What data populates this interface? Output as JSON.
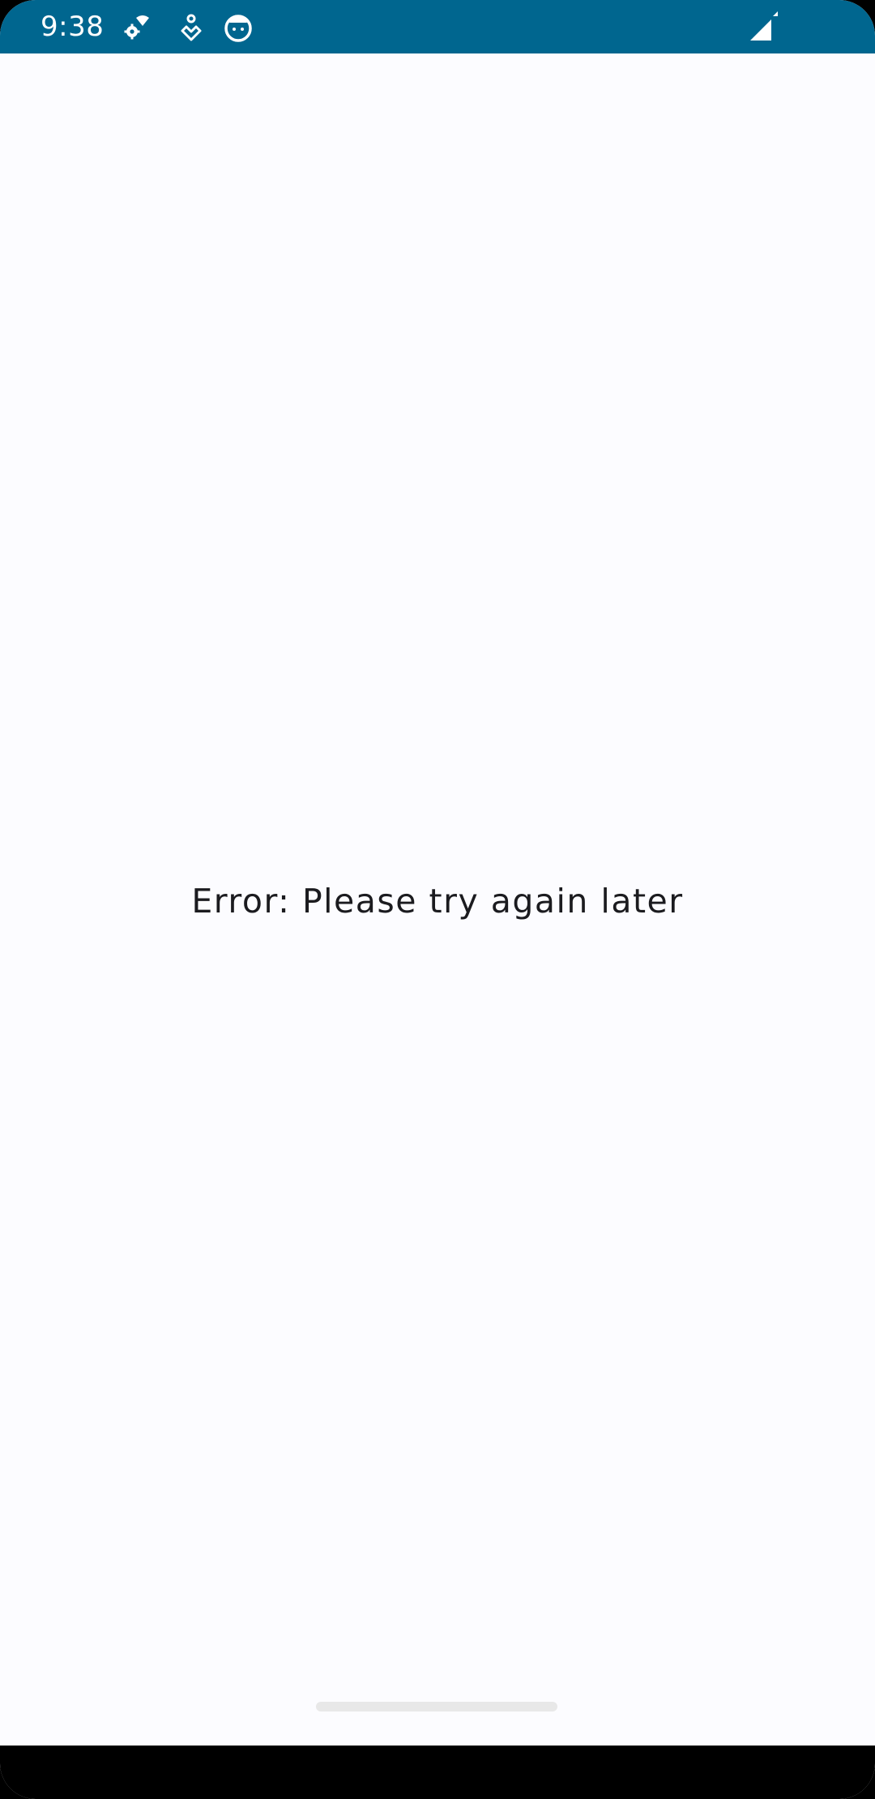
{
  "status_bar": {
    "time": "9:38",
    "icons": [
      "settings-wifi-icon",
      "location-icon",
      "face-icon",
      "cellular-signal-icon"
    ],
    "background_color": "#00668f"
  },
  "main": {
    "error_message": "Error: Please try again later",
    "background_color": "#fcfcff",
    "text_color": "#1b1b1f"
  },
  "navigation": {
    "type": "gesture-handle"
  }
}
